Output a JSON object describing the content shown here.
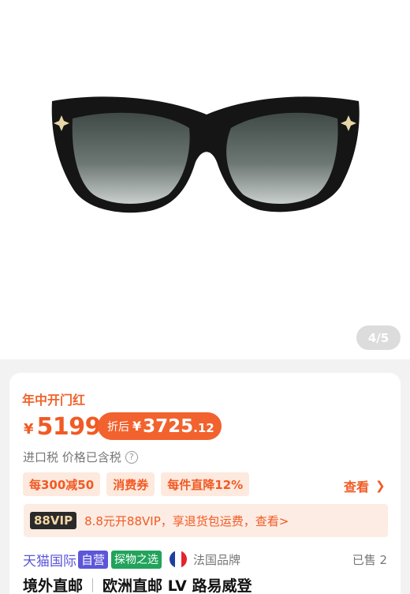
{
  "gallery": {
    "counter": "4/5"
  },
  "promo": {
    "title": "年中开门红"
  },
  "price": {
    "currency": "¥",
    "value": "5199",
    "after_label": "折后",
    "after_currency": "¥",
    "after_integer": "3725",
    "after_decimal": ".12"
  },
  "tax": {
    "text": "进口税 价格已含税",
    "info_icon": "question-circle-icon"
  },
  "coupons": {
    "tags": [
      "每300减50",
      "消费券",
      "每件直降12%"
    ],
    "see_more": "查看",
    "see_more_icon": "chevron-right-icon"
  },
  "vip": {
    "badge": "88VIP",
    "text": "8.8元开88VIP，享退货包运费，查看>"
  },
  "shop": {
    "tmall": "天猫国际",
    "ziying": "自营",
    "tanwu": "探物之选",
    "flag_icon": "france-flag-icon",
    "origin": "法国品牌",
    "sold": "已售 2"
  },
  "product": {
    "tag": "境外直邮",
    "title": "欧洲直邮 LV 路易威登"
  },
  "colors": {
    "accent": "#f15a24",
    "tmall": "#5c56d9",
    "tanwu": "#21a35b"
  }
}
